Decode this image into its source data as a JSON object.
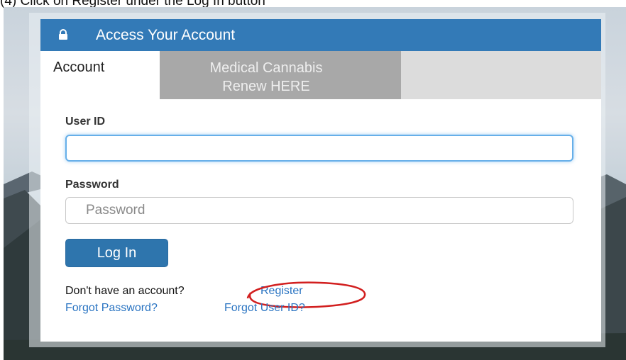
{
  "caption": "(4) Click on Register under the Log In button",
  "panel": {
    "title": "Access Your Account"
  },
  "tabs": [
    {
      "label": "Account"
    },
    {
      "label_line1": "Medical Cannabis",
      "label_line2": "Renew HERE"
    }
  ],
  "form": {
    "user_id_label": "User ID",
    "user_id_value": "",
    "password_label": "Password",
    "password_placeholder": "Password",
    "login_button": "Log In"
  },
  "links": {
    "no_account_text": "Don't have an account?",
    "register": "Register",
    "forgot_password": "Forgot Password?",
    "forgot_user_id": "Forgot User ID?"
  },
  "colors": {
    "header": "#337ab7",
    "link": "#2a74c2",
    "annotation": "#d21f1f"
  }
}
